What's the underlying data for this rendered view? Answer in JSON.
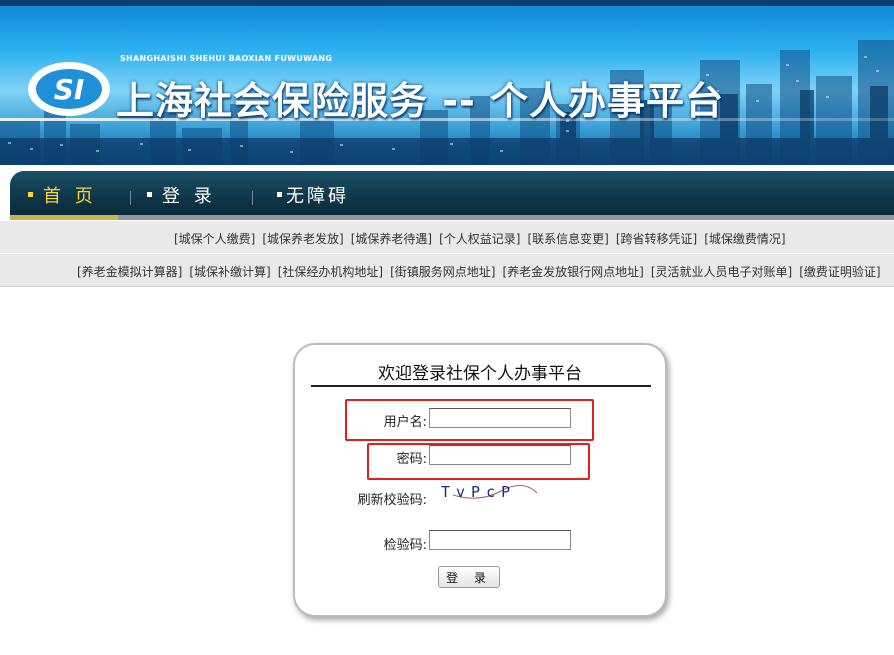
{
  "header": {
    "logo_mark": "SI",
    "pinyin": "SHANGHAISHI SHEHUI BAOXIAN FUWUWANG",
    "title": "上海社会保险服务 -- 个人办事平台",
    "colors": {
      "sky_top": "#0c83d4",
      "sky_mid": "#7fd3f6",
      "sky_bottom": "#0e5d9a"
    }
  },
  "nav": {
    "items": [
      {
        "label": "首 页",
        "active": true
      },
      {
        "label": "登 录",
        "active": false
      },
      {
        "label": "无障碍",
        "active": false
      }
    ],
    "colors": {
      "bar": "#0e3547",
      "active_text": "#ffd23a",
      "active_underline": "#c5b44a"
    }
  },
  "links": {
    "row1": [
      "[城保个人缴费]",
      "[城保养老发放]",
      "[城保养老待遇]",
      "[个人权益记录]",
      "[联系信息变更]",
      "[跨省转移凭证]",
      "[城保缴费情况]"
    ],
    "row2": [
      "[养老金模拟计算器]",
      "[城保补缴计算]",
      "[社保经办机构地址]",
      "[街镇服务网点地址]",
      "[养老金发放银行网点地址]",
      "[灵活就业人员电子对账单]",
      "[缴费证明验证]"
    ]
  },
  "login": {
    "title": "欢迎登录社保个人办事平台",
    "username_label": "用户名:",
    "username_value": "",
    "password_label": "密码:",
    "password_value": "",
    "refresh_label": "刷新校验码:",
    "captcha_text": "TvPcP",
    "verify_label": "检验码:",
    "verify_value": "",
    "submit_label": "登 录",
    "highlight_color": "#e02020"
  }
}
